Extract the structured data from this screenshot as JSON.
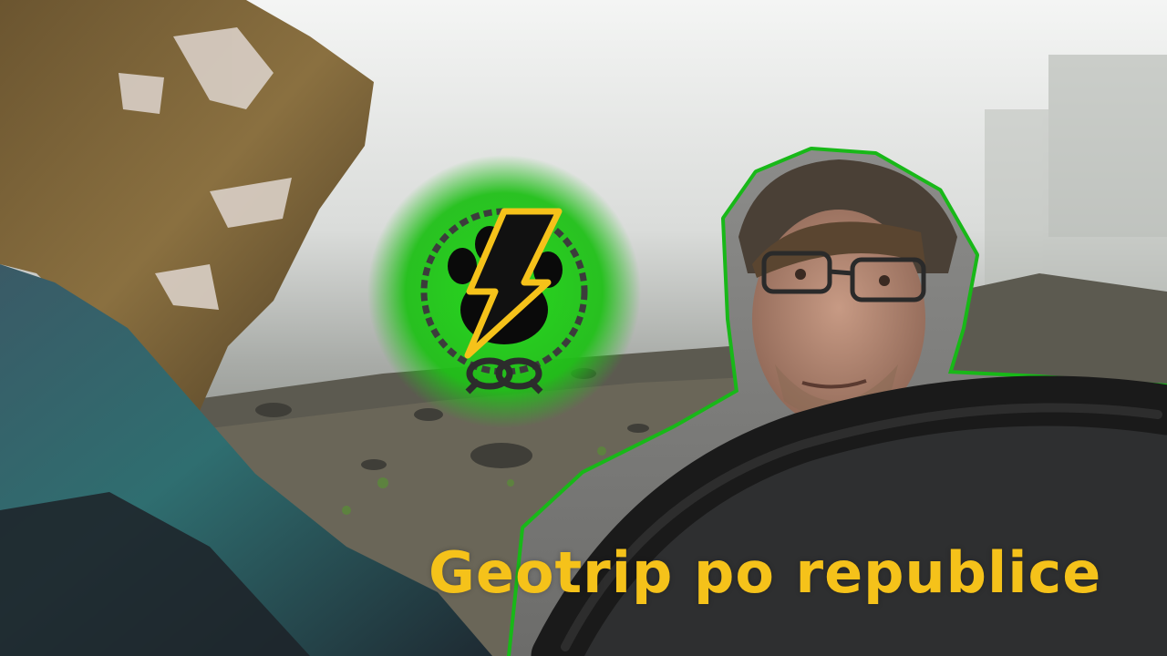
{
  "title": "Geotrip po republice",
  "colors": {
    "title": "#f5c21a",
    "logo_glow": "#27d81e",
    "logo_bolt": "#f5c21a",
    "outline": "#18b818",
    "fog": "#d8dcd8"
  },
  "icons": [
    "paw-print-icon",
    "lightning-bolt-icon",
    "rope-knot-icon"
  ]
}
